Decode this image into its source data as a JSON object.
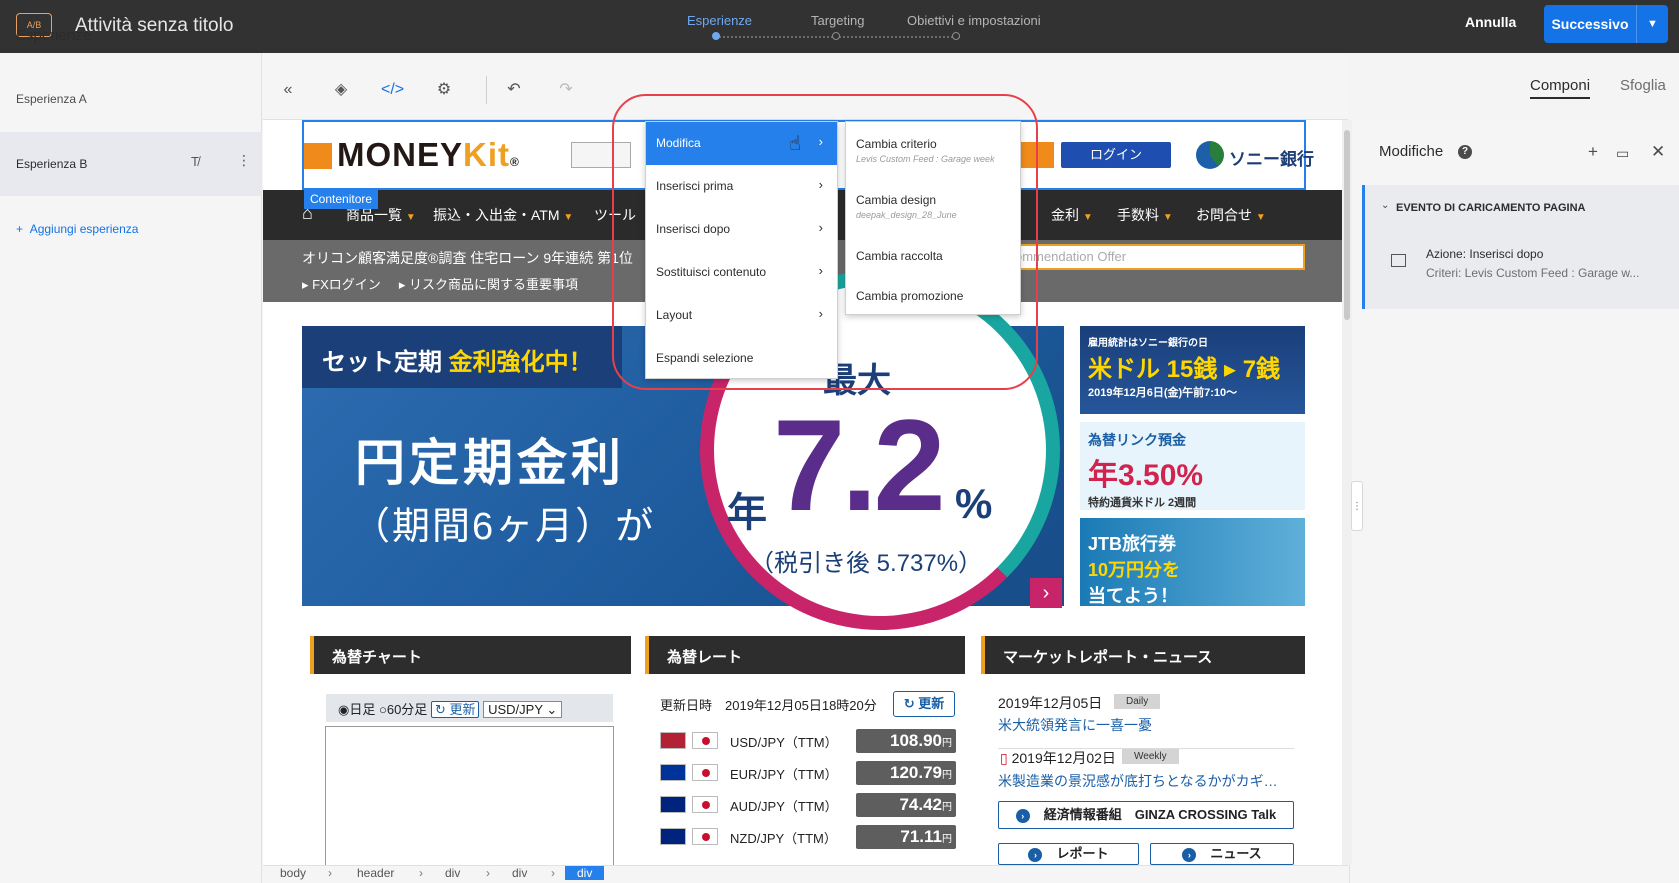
{
  "topbar": {
    "badge": "A/B",
    "title": "Attività senza titolo",
    "steps": [
      "Esperienze",
      "Targeting",
      "Obiettivi e impostazioni"
    ],
    "cancel": "Annulla",
    "next": "Successivo"
  },
  "left_panel": {
    "title": "Esperienze",
    "experiences": [
      "Esperienza A",
      "Esperienza B"
    ],
    "add": "Aggiungi esperienza"
  },
  "toolbar": {
    "tabs": [
      "Componi",
      "Sfoglia"
    ]
  },
  "right_panel": {
    "title": "Modifiche",
    "section": "EVENTO DI CARICAMENTO PAGINA",
    "action": "Azione: Inserisci dopo",
    "criteria": "Criteri: Levis Custom Feed : Garage w..."
  },
  "site": {
    "logo_main": "MONEY",
    "logo_accent": "Kit",
    "logo_mark": "®",
    "login": "ログイン",
    "bank": "ソニー銀行",
    "container_label": "Contenitore",
    "nav": [
      "商品一覧",
      "振込・入出金・ATM",
      "ツール",
      "金利",
      "手数料",
      "お問合せ"
    ],
    "notice": "オリコン顧客満足度®調査 住宅ローン 9年連続 第1位",
    "links": [
      "FXログイン",
      "リスク商品に関する重要事項"
    ],
    "rec_placeholder": "ommendation Offer",
    "banner": {
      "top_prefix": "セット定期 ",
      "top_highlight": "金利強化中！",
      "big": "円定期金利",
      "sub": "（期間6ヶ月）が",
      "max": "最大",
      "year": "年",
      "rate": "7.2",
      "pct": "%",
      "after": "（税引き後 5.737%）"
    },
    "ads": [
      {
        "line1": "雇用統計はソニー銀行の日",
        "line2": "米ドル 15銭 ▸ 7銭",
        "line3": "2019年12月6日(金)午前7:10～"
      },
      {
        "line1": "為替リンク預金",
        "line2": "年3.50%",
        "line3": "特約通貨米ドル 2週間"
      },
      {
        "line1": "JTB旅行券",
        "line2": "10万円分を",
        "line3": "当てよう！"
      }
    ],
    "boxes": [
      "為替チャート",
      "為替レート",
      "マーケットレポート・ニュース"
    ],
    "chart_ctrl": {
      "opt1": "日足",
      "opt2": "60分足",
      "update": "更新",
      "pair": "USD/JPY ⌄"
    },
    "rates": {
      "date": "更新日時　2019年12月05日18時20分",
      "update": "更新",
      "rows": [
        {
          "pair": "USD/JPY（TTM）",
          "value": "108.90",
          "unit": "円",
          "flag": "#b22234"
        },
        {
          "pair": "EUR/JPY（TTM）",
          "value": "120.79",
          "unit": "円",
          "flag": "#003399"
        },
        {
          "pair": "AUD/JPY（TTM）",
          "value": "74.42",
          "unit": "円",
          "flag": "#00247d"
        },
        {
          "pair": "NZD/JPY（TTM）",
          "value": "71.11",
          "unit": "円",
          "flag": "#00247d"
        }
      ]
    },
    "news": [
      {
        "date": "2019年12月05日",
        "badge": "Daily",
        "title": "米大統領発言に一喜一憂"
      },
      {
        "date": "2019年12月02日",
        "badge": "Weekly",
        "title": "米製造業の景況感が底打ちとなるかがカギ…"
      }
    ],
    "news_buttons": [
      "経済情報番組　GINZA CROSSING Talk",
      "レポート",
      "ニュース"
    ]
  },
  "breadcrumb": [
    "body",
    "header",
    "div",
    "div",
    "div"
  ],
  "context_menu": {
    "items": [
      "Modifica",
      "Inserisci prima",
      "Inserisci dopo",
      "Sostituisci contenuto",
      "Layout",
      "Espandi selezione"
    ],
    "submenu": [
      {
        "label": "Cambia criterio",
        "sub": "Levis Custom Feed : Garage week"
      },
      {
        "label": "Cambia design",
        "sub": "deepak_design_28_June"
      },
      {
        "label": "Cambia raccolta",
        "sub": ""
      },
      {
        "label": "Cambia promozione",
        "sub": ""
      }
    ]
  },
  "colors": {
    "accent": "#1473e6",
    "highlight": "#e8404a",
    "brand_orange": "#f08a1a"
  }
}
